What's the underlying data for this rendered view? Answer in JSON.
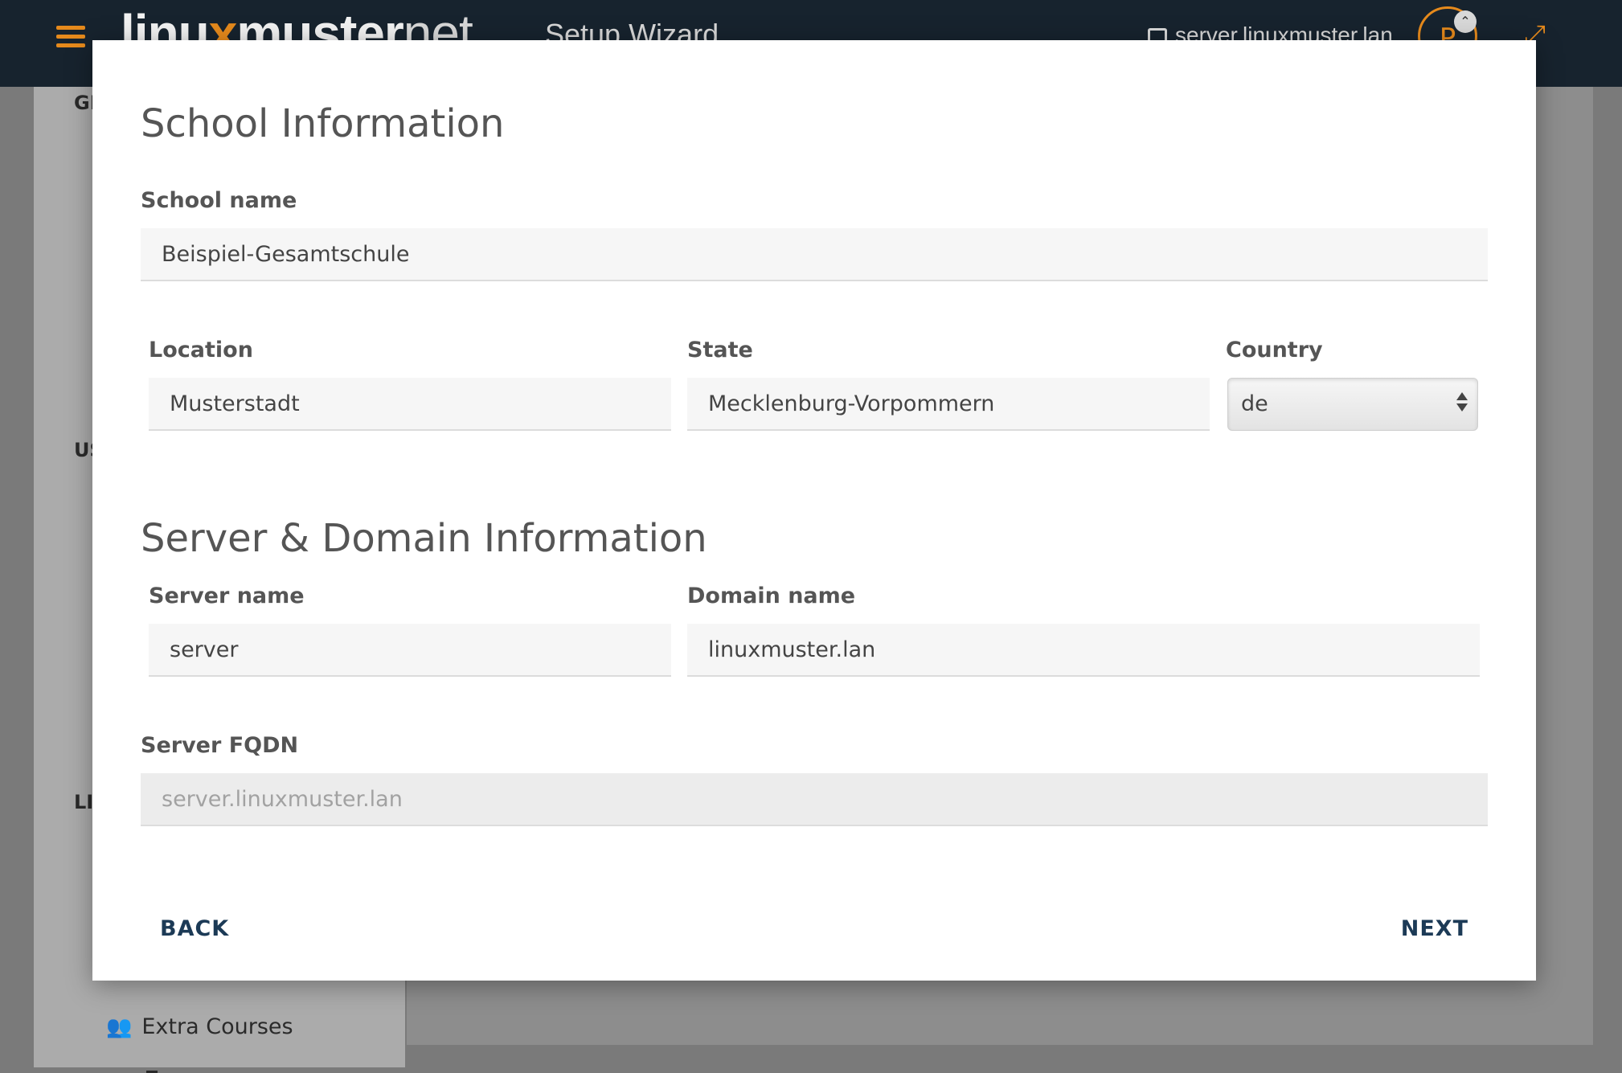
{
  "header": {
    "logo_main": "linu",
    "logo_dots": "x",
    "logo_muster": "muster",
    "logo_net": "net",
    "title": "Setup Wizard",
    "hostname": "server.linuxmuster.lan",
    "avatar_initial": "P"
  },
  "sidebar": {
    "section1": "GE",
    "section2": "US",
    "section3": "LI",
    "extra_courses": "Extra Courses"
  },
  "modal": {
    "school_title": "School Information",
    "school_name_label": "School name",
    "school_name_value": "Beispiel-Gesamtschule",
    "location_label": "Location",
    "location_value": "Musterstadt",
    "state_label": "State",
    "state_value": "Mecklenburg-Vorpommern",
    "country_label": "Country",
    "country_value": "de",
    "server_title": "Server & Domain Information",
    "server_name_label": "Server name",
    "server_name_value": "server",
    "domain_name_label": "Domain name",
    "domain_name_value": "linuxmuster.lan",
    "fqdn_label": "Server FQDN",
    "fqdn_value": "server.linuxmuster.lan",
    "back_label": "BACK",
    "next_label": "NEXT"
  },
  "colors": {
    "topbar": "#17232e",
    "accent": "#e68a1c",
    "button_text": "#1c3a56"
  },
  "icons": [
    "hamburger-icon",
    "lock-icon",
    "chevron-up-icon",
    "expand-icon",
    "users-icon"
  ]
}
